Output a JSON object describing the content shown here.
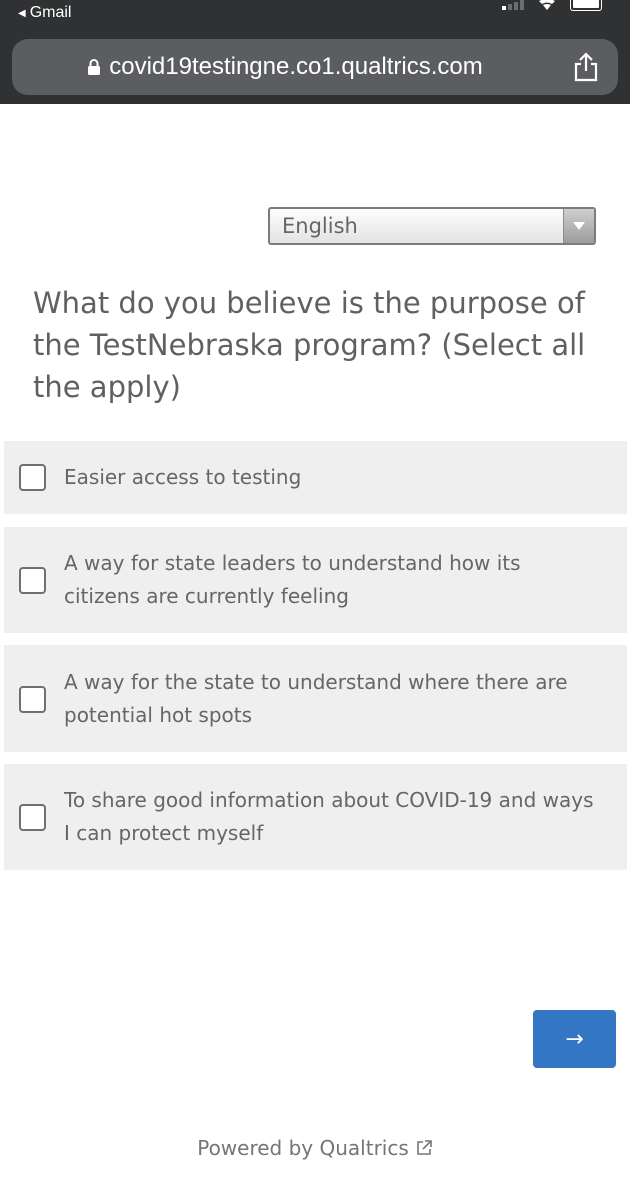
{
  "status_bar": {
    "back_label": "Gmail"
  },
  "browser": {
    "url": "covid19testingne.co1.qualtrics.com",
    "icons": [
      "lock-icon",
      "share-icon"
    ]
  },
  "language_select": {
    "selected": "English"
  },
  "question": {
    "text": "What do you believe is the purpose of the TestNebraska program? (Select all the apply)"
  },
  "choices": [
    {
      "label": "Easier access to testing",
      "checked": false
    },
    {
      "label": "A way for state leaders to understand how its citizens are currently feeling",
      "checked": false
    },
    {
      "label": "A way for the state to understand where there are potential hot spots",
      "checked": false
    },
    {
      "label": "To share good information about COVID-19 and ways I can protect myself",
      "checked": false
    }
  ],
  "next_button": {
    "label": "→"
  },
  "footer": {
    "powered_by": "Powered by Qualtrics"
  },
  "colors": {
    "chrome": "#2f3133",
    "url_bar": "#5b5d60",
    "choice_bg": "#efefef",
    "accent": "#3377c4"
  }
}
